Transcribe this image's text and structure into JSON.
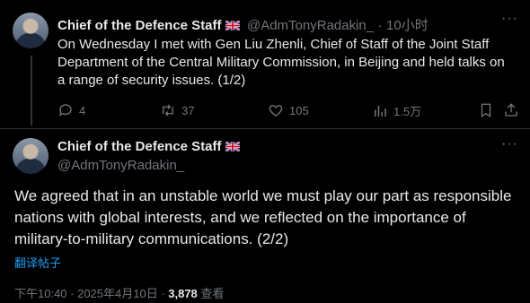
{
  "tweet1": {
    "author_name": "Chief of the Defence Staff",
    "handle": "@AdmTonyRadakin_",
    "separator": "·",
    "time": "10小时",
    "flag_icon": "uk-flag-icon",
    "text": "On Wednesday I met with Gen Liu Zhenli, Chief of Staff of the Joint Staff Department of the Central Military Commission, in Beijing and held talks on a range of security issues. (1/2)",
    "replies": "4",
    "retweets": "37",
    "likes": "105",
    "views": "1.5万"
  },
  "tweet2": {
    "author_name": "Chief of the Defence Staff",
    "handle": "@AdmTonyRadakin_",
    "flag_icon": "uk-flag-icon",
    "text": "We agreed that in an unstable world we must play our part as responsible nations with global interests, and we reflected on the importance of military-to-military communications. (2/2)",
    "translate_label": "翻译帖子",
    "timestamp": "下午10:40 · 2025年4月10日 · ",
    "view_count": "3,878",
    "views_label": " 查看"
  },
  "colors": {
    "background": "#000000",
    "text": "#e7e9ea",
    "muted": "#71767b",
    "link": "#1d9bf0"
  }
}
